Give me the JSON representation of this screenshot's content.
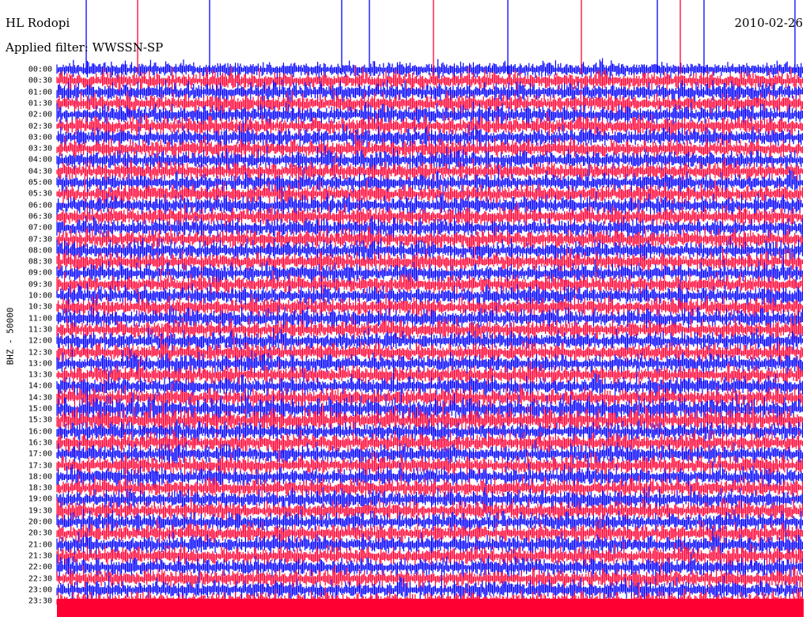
{
  "header": {
    "station": "HL Rodopi",
    "date": "2010-02-26",
    "filter": "Applied filter: WWSSN-SP"
  },
  "colors": {
    "trace_a": "#0000ff",
    "trace_b": "#ff0033",
    "background": "#ffffff"
  },
  "chart_data": {
    "type": "line",
    "chart_kind": "helicorder seismogram (24-hour drum plot)",
    "ylabel": "BHZ - 50000",
    "ytick_labels": [
      "00:00",
      "00:30",
      "01:00",
      "01:30",
      "02:00",
      "02:30",
      "03:00",
      "03:30",
      "04:00",
      "04:30",
      "05:00",
      "05:30",
      "06:00",
      "06:30",
      "07:00",
      "07:30",
      "08:00",
      "08:30",
      "09:00",
      "09:30",
      "10:00",
      "10:30",
      "11:00",
      "11:30",
      "12:00",
      "12:30",
      "13:00",
      "13:30",
      "14:00",
      "14:30",
      "15:00",
      "15:30",
      "16:00",
      "16:30",
      "17:00",
      "17:30",
      "18:00",
      "18:30",
      "19:00",
      "19:30",
      "20:00",
      "20:30",
      "21:00",
      "21:30",
      "22:00",
      "22:30",
      "23:00",
      "23:30"
    ],
    "alternating_trace_colors": [
      "#0000ff",
      "#ff0033"
    ],
    "grid": false,
    "legend": "none"
  }
}
